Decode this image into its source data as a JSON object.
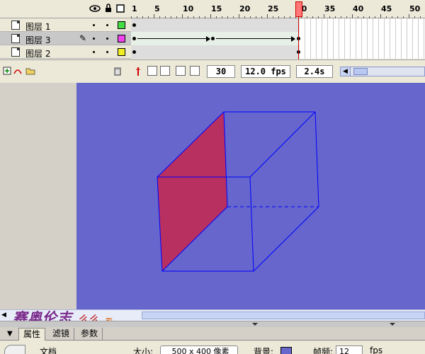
{
  "timeline": {
    "ruler": [
      "1",
      "5",
      "10",
      "15",
      "20",
      "25",
      "30",
      "35",
      "40",
      "45",
      "50"
    ],
    "layers": [
      {
        "name": "图层 1",
        "color": "#44dd44",
        "selected": false
      },
      {
        "name": "图层 3",
        "color": "#ee44ee",
        "selected": true
      },
      {
        "name": "图层 2",
        "color": "#eeee22",
        "selected": false
      }
    ],
    "current_frame": "30",
    "frame_rate": "12.0 fps",
    "elapsed": "2.4s"
  },
  "stage": {
    "background": "#6666cc",
    "cube_stroke": "#0000ff",
    "face_fill": "#b83060"
  },
  "watermark": {
    "text": "赛奥伦志",
    "tail": "么么"
  },
  "panel": {
    "tabs": [
      "属性",
      "滤镜",
      "参数"
    ],
    "doc_type": "文档",
    "size_label": "大小:",
    "size_value": "500 x 400 像素",
    "bg_label": "背景:",
    "bg_color": "#6666cc",
    "fps_label": "帧频:",
    "fps_value": "12",
    "fps_unit": "fps"
  }
}
